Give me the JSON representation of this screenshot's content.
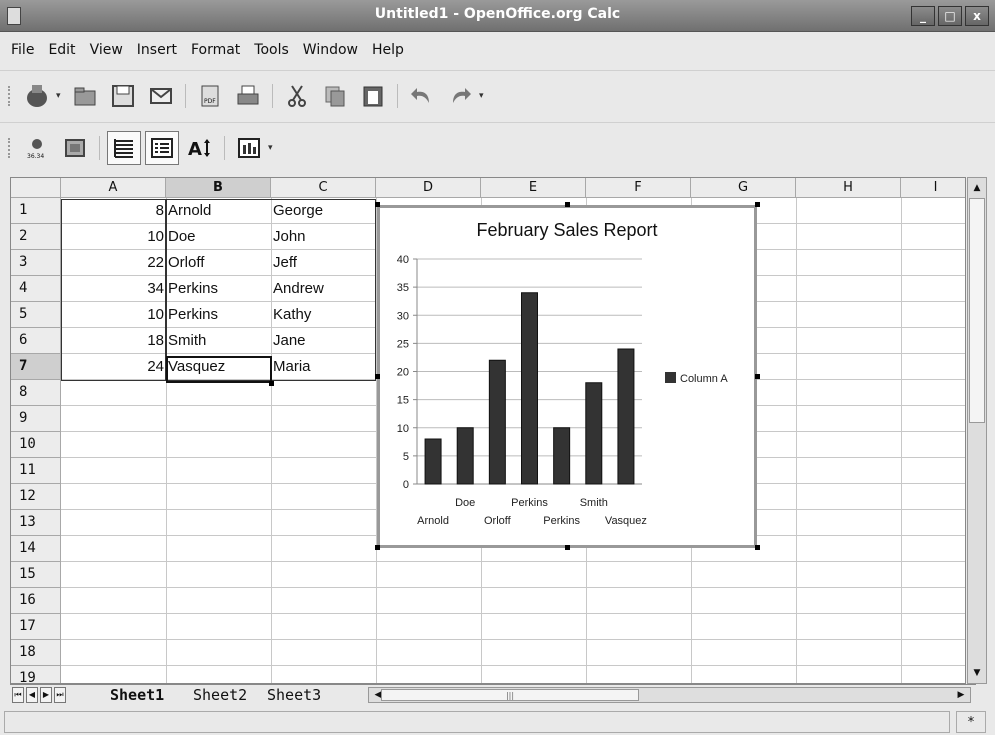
{
  "window": {
    "title": "Untitled1 - OpenOffice.org Calc",
    "controls": [
      "_",
      "□",
      "x"
    ]
  },
  "menu": [
    "File",
    "Edit",
    "View",
    "Insert",
    "Format",
    "Tools",
    "Window",
    "Help"
  ],
  "toolbar1": {
    "icons": [
      "chart-type-icon",
      "open-icon",
      "save-icon",
      "email-icon",
      "pdf-icon",
      "print-icon",
      "cut-icon",
      "copy-icon",
      "paste-icon",
      "undo-icon",
      "redo-icon"
    ]
  },
  "toolbar2": {
    "icons": [
      "data-labels-icon",
      "chart-wall-icon",
      "horizontal-grid-icon",
      "legend-on-off-icon",
      "scale-text-icon",
      "chart-data-table-icon"
    ]
  },
  "sheet": {
    "columns": [
      "A",
      "B",
      "C",
      "D",
      "E",
      "F",
      "G",
      "H",
      "I"
    ],
    "selected_column": "B",
    "rows": [
      "1",
      "2",
      "3",
      "4",
      "5",
      "6",
      "7",
      "8",
      "9",
      "10",
      "11",
      "12",
      "13",
      "14",
      "15",
      "16",
      "17",
      "18",
      "19"
    ],
    "selected_row": "7",
    "data": [
      {
        "a": "8",
        "b": "Arnold",
        "c": "George"
      },
      {
        "a": "10",
        "b": "Doe",
        "c": "John"
      },
      {
        "a": "22",
        "b": "Orloff",
        "c": "Jeff"
      },
      {
        "a": "34",
        "b": "Perkins",
        "c": "Andrew"
      },
      {
        "a": "10",
        "b": "Perkins",
        "c": "Kathy"
      },
      {
        "a": "18",
        "b": "Smith",
        "c": "Jane"
      },
      {
        "a": "24",
        "b": "Vasquez",
        "c": "Maria"
      }
    ]
  },
  "chart_data": {
    "type": "bar",
    "title": "February Sales Report",
    "categories": [
      "Arnold",
      "Doe",
      "Orloff",
      "Perkins",
      "Perkins",
      "Smith",
      "Vasquez"
    ],
    "series": [
      {
        "name": "Column A",
        "values": [
          8,
          10,
          22,
          34,
          10,
          18,
          24
        ]
      }
    ],
    "ylim": [
      0,
      40
    ],
    "yticks": [
      "0",
      "5",
      "10",
      "15",
      "20",
      "25",
      "30",
      "35",
      "40"
    ],
    "grid": true,
    "legend": "right",
    "bar_color": "#333333"
  },
  "tabs": [
    "Sheet1",
    "Sheet2",
    "Sheet3"
  ],
  "statusbar": {
    "modified": "*"
  }
}
